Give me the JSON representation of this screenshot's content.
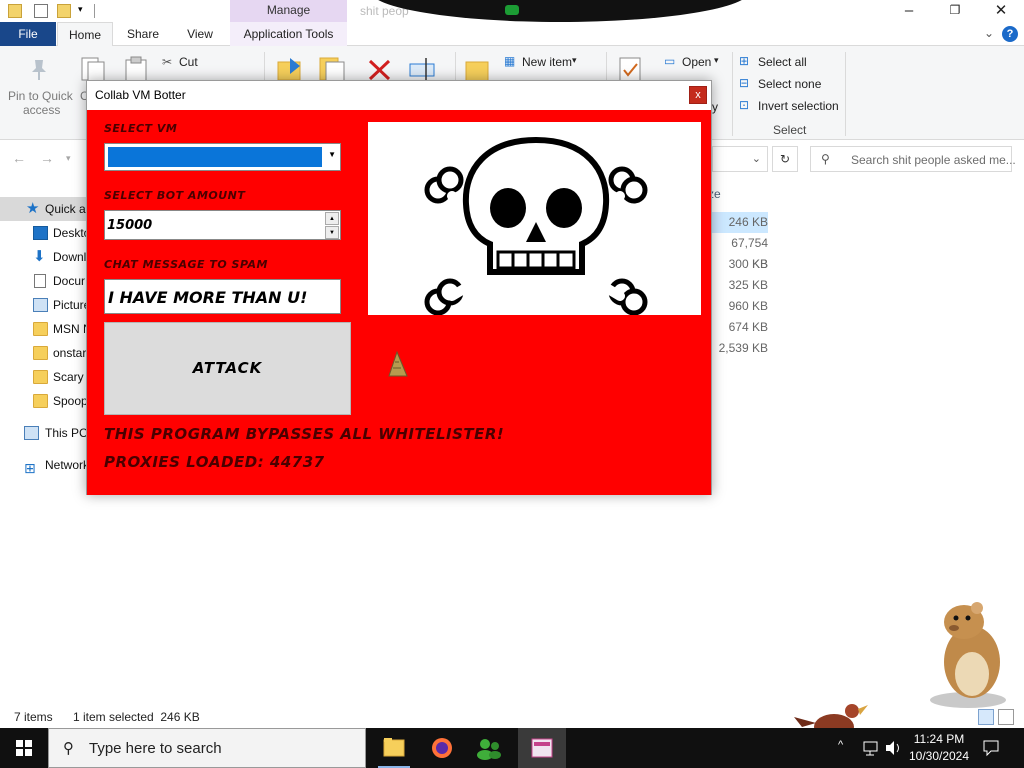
{
  "explorer": {
    "title_tab": "Manage",
    "ghost_title": "shit peop",
    "window_controls": [
      "–",
      "❐",
      "✕"
    ],
    "tabs": {
      "file": "File",
      "home": "Home",
      "share": "Share",
      "view": "View",
      "app_tools": "Application Tools"
    },
    "ribbon": {
      "pin": [
        "Pin to Quick",
        "access"
      ],
      "copy_partial": "C",
      "cut": "Cut",
      "new_item": "New item",
      "open": "Open",
      "history_partial": "y",
      "select_all": "Select all",
      "select_none": "Select none",
      "invert_selection": "Invert selection",
      "select_group": "Select"
    },
    "search_placeholder": "Search shit people asked me...",
    "nav_items": [
      {
        "label": "Quick a",
        "icon": "star-icon"
      },
      {
        "label": "Deskto",
        "icon": "desktop-icon"
      },
      {
        "label": "Downl",
        "icon": "download-icon"
      },
      {
        "label": "Docur",
        "icon": "document-icon"
      },
      {
        "label": "Picture",
        "icon": "pictures-icon"
      },
      {
        "label": "MSN N",
        "icon": "folder-icon"
      },
      {
        "label": "onstar",
        "icon": "folder-icon"
      },
      {
        "label": "Scary S",
        "icon": "folder-icon"
      },
      {
        "label": "Spoop",
        "icon": "folder-icon"
      },
      {
        "label": "This PC",
        "icon": "this-pc-icon"
      },
      {
        "label": "Network",
        "icon": "network-icon"
      }
    ],
    "size_header": "ze",
    "sizes": [
      "246 KB",
      "67,754 KB",
      "300 KB",
      "325 KB",
      "960 KB",
      "674 KB",
      "2,539 KB"
    ],
    "status": {
      "items": "7 items",
      "selected": "1 item selected  246 KB"
    }
  },
  "bot": {
    "title": "Collab VM Botter",
    "close": "x",
    "select_vm_label": "SELECT VM",
    "bot_amount_label": "SELECT BOT AMOUNT",
    "bot_amount_value": "15000",
    "chat_label": "CHAT MESSAGE TO SPAM",
    "chat_value": "I HAVE MORE THAN U!",
    "attack_label": "ATTACK",
    "footer1": "THIS PROGRAM BYPASSES ALL WHITELISTER!",
    "footer2": "PROXIES LOADED: 44737",
    "colors": {
      "background": "#ff0000",
      "dropdown_fill": "#0a75d9"
    }
  },
  "taskbar": {
    "search_placeholder": "Type here to search",
    "time": "11:24 PM",
    "date": "10/30/2024"
  }
}
